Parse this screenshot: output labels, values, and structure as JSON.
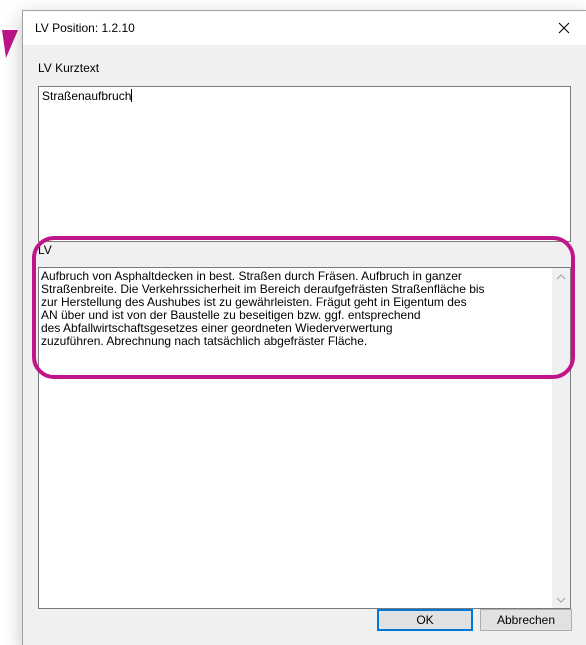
{
  "window": {
    "title": "LV Position: 1.2.10"
  },
  "kurztext": {
    "label": "LV Kurztext",
    "value": "Straßenaufbruch"
  },
  "lv": {
    "label": "LV",
    "value": "Aufbruch von Asphaltdecken in best. Straßen durch Fräsen. Aufbruch in ganzer\nStraßenbreite. Die Verkehrssicherheit im Bereich deraufgefrästen Straßenfläche bis\nzur Herstellung des Aushubes ist zu gewährleisten. Frägut geht in Eigentum des\nAN über und ist von der Baustelle zu beseitigen bzw. ggf. entsprechend\ndes Abfallwirtschaftsgesetzes einer geordneten Wiederverwertung\nzuzuführen. Abrechnung nach tatsächlich abgefräster Fläche."
  },
  "buttons": {
    "ok": "OK",
    "cancel": "Abbrechen"
  },
  "icons": {
    "close": "close-icon",
    "scroll_up": "chevron-up-icon",
    "scroll_down": "chevron-down-icon",
    "pointer": "arrow-icon"
  },
  "colors": {
    "highlight": "#c0148a",
    "dialog_bg": "#f0f0f0",
    "focus_border": "#0078d7"
  }
}
